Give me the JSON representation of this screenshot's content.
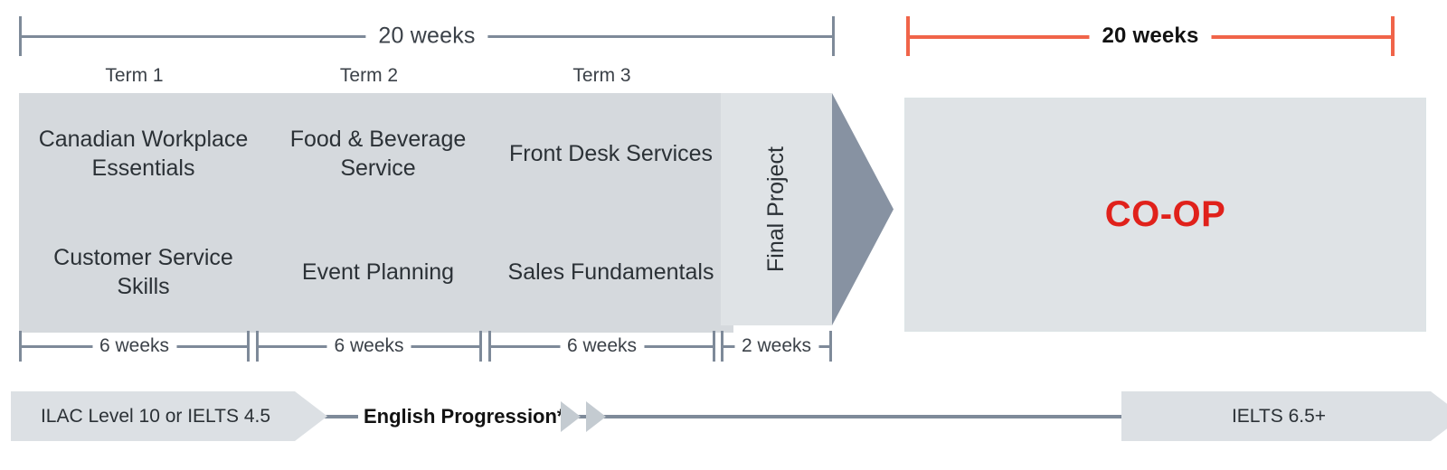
{
  "top_brackets": [
    {
      "label": "20 weeks",
      "color": "#7E8A99",
      "style": "gray",
      "weeks": 20
    },
    {
      "label": "20 weeks",
      "color": "#F06449",
      "style": "red",
      "weeks": 20
    }
  ],
  "terms": [
    {
      "label": "Term 1"
    },
    {
      "label": "Term 2"
    },
    {
      "label": "Term 3"
    }
  ],
  "courses": {
    "row1": [
      {
        "title": "Canadian Workplace Essentials"
      },
      {
        "title": "Food & Beverage Service"
      },
      {
        "title": "Front Desk Services"
      }
    ],
    "row2": [
      {
        "title": "Customer Service Skills"
      },
      {
        "title": "Event Planning"
      },
      {
        "title": "Sales Fundamentals"
      }
    ]
  },
  "final_project": {
    "label": "Final Project"
  },
  "week_brackets": [
    {
      "label": "6 weeks",
      "weeks": 6
    },
    {
      "label": "6 weeks",
      "weeks": 6
    },
    {
      "label": "6 weeks",
      "weeks": 6
    },
    {
      "label": "2 weeks",
      "weeks": 2
    }
  ],
  "coop": {
    "label": "CO-OP",
    "color": "#E0211B"
  },
  "arrow": {
    "name": "right-arrow",
    "color": "#8792A2"
  },
  "english_progression": {
    "entry_requirement": "ILAC Level 10 or IELTS 4.5",
    "middle_label": "English Progression*",
    "exit_requirement": "IELTS 6.5+"
  },
  "colors": {
    "course_box": "#D5D9DD",
    "panel_box": "#DFE3E6",
    "line_gray": "#7E8A99",
    "accent_red": "#F06449",
    "coop_red": "#E0211B",
    "arrow_gray": "#8792A2",
    "chevron_gray": "#DCE0E4"
  }
}
